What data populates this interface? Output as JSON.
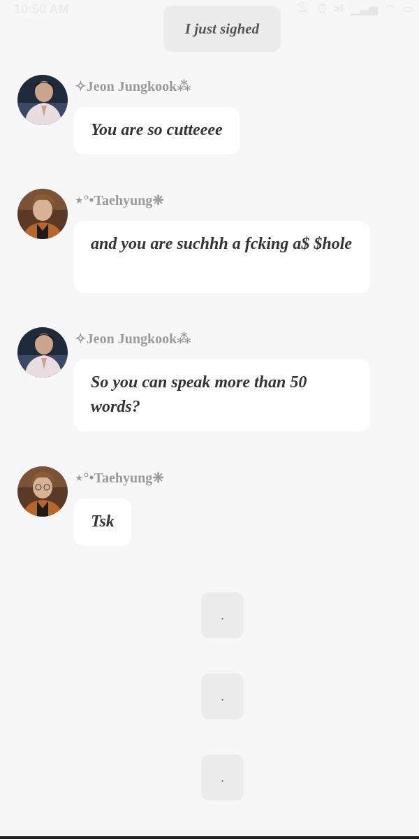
{
  "status_bar": {
    "time": "10:50 AM"
  },
  "system_message": "I just sighed",
  "messages": [
    {
      "sender": "✧Jeon Jungkook⁂",
      "text": "You are so cutteeee",
      "avatar": "jungkook-avatar"
    },
    {
      "sender": "⋆°•Taehyung❈",
      "text": "and you are suchhh a fcking a$ $hole",
      "avatar": "taehyung-avatar"
    },
    {
      "sender": "✧Jeon Jungkook⁂",
      "text": "So you can speak more than 50 words?",
      "avatar": "jungkook-avatar"
    },
    {
      "sender": "⋆°•Taehyung❈",
      "text": "Tsk",
      "avatar": "taehyung-avatar"
    }
  ],
  "dot_messages": [
    ".",
    ".",
    "."
  ]
}
